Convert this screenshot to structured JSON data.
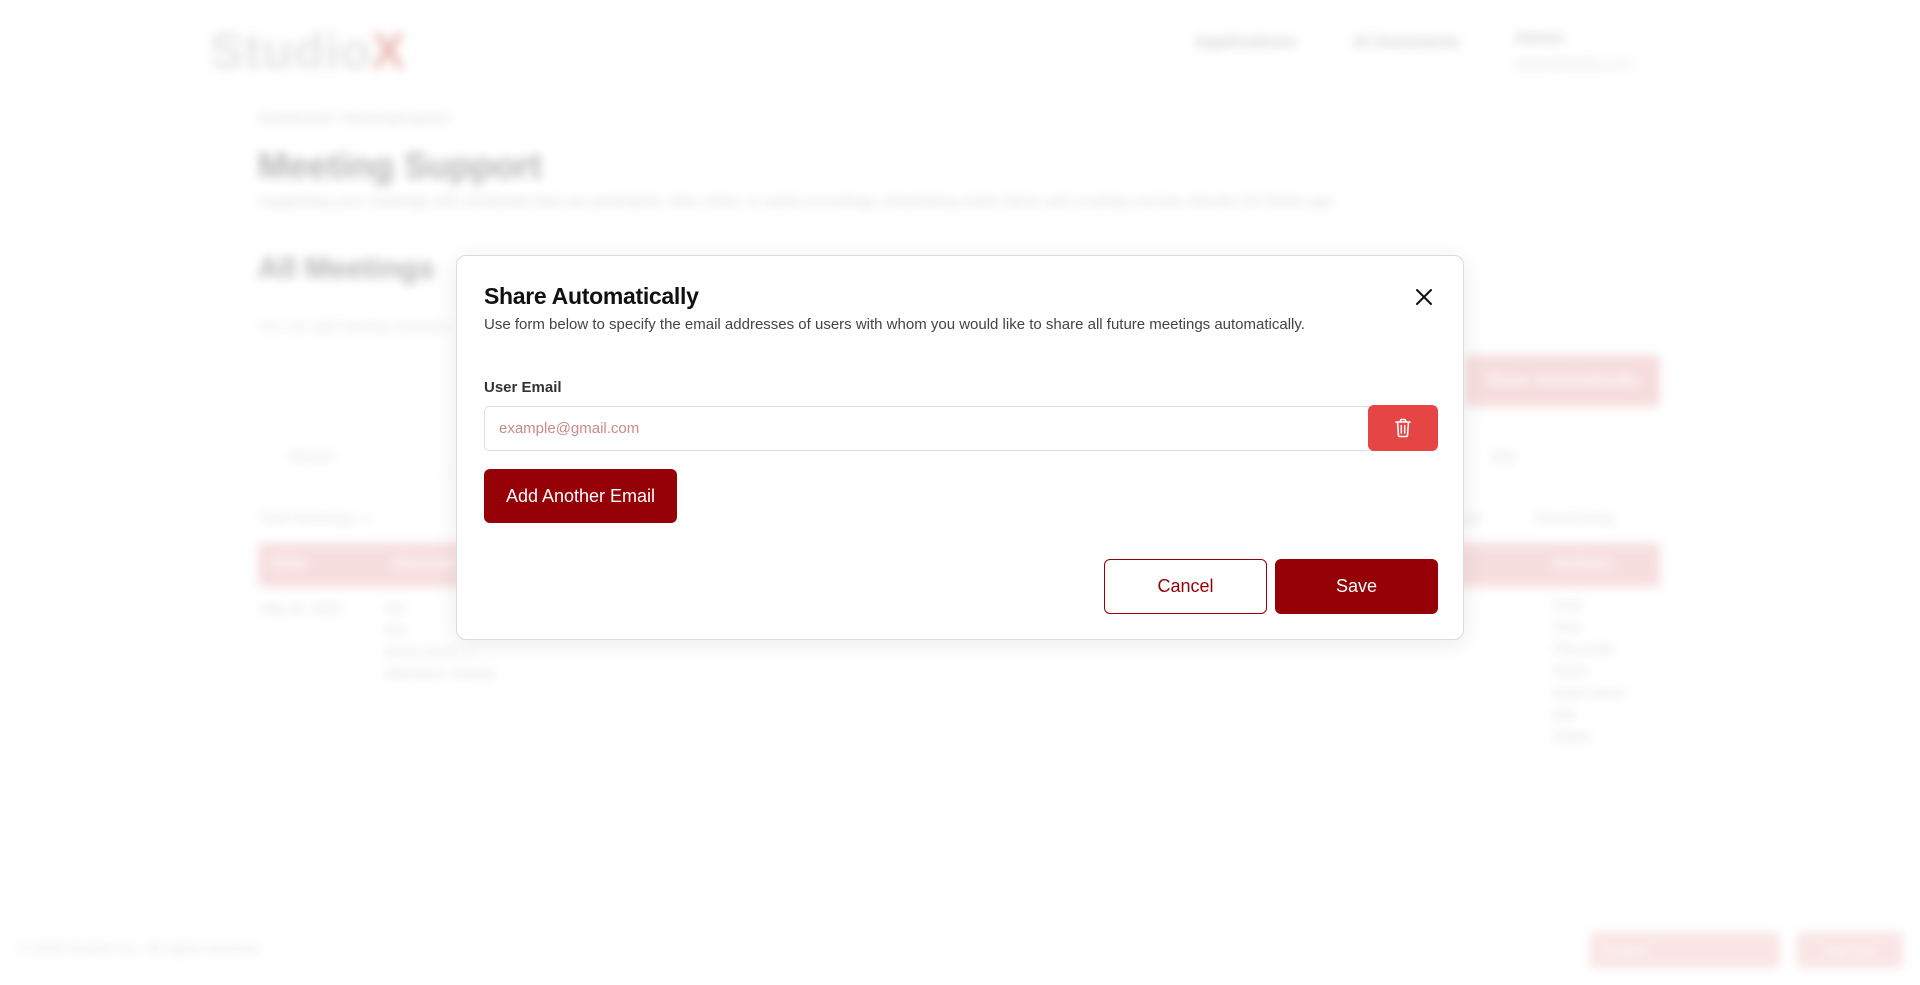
{
  "background": {
    "logo_text": "Studio",
    "logo_x": "X",
    "nav": [
      "Applications",
      "AI Assistants"
    ],
    "user_name": "Admin",
    "user_email": "admin@studiox.com",
    "breadcrumb": "Dashboard  /  MeetingSupport",
    "page_title": "Meeting Support",
    "page_subtitle": "Supporting your meetings with assistants that can participate, take notes, or audio recordings, pinpointing action items and creating concise minutes for follow-ups",
    "section_title": "All Meetings",
    "section_subtitle": "You can add meeting assistant",
    "share_button": "Share Automatically",
    "search_placeholder": "Search",
    "filter_select": "Any",
    "total_meetings": "Total Meetings: 1",
    "sort_by": "Date",
    "sort_order": "Descending",
    "table_headers": [
      "Date",
      "Description",
      "Actions"
    ],
    "row_date": "May 26, 2025",
    "row_description": [
      "test",
      "test",
      "Action Items: 1",
      "Attendees: Sample"
    ],
    "row_actions": [
      "Chat",
      "View",
      "Play Audio",
      "Share",
      "Action Items",
      "Edit",
      "Delete"
    ],
    "footer_copyright": "© 2025 StudioX Inc. All rights reserved.",
    "footer_language": "English",
    "footer_signout": "Sign Out"
  },
  "modal": {
    "title": "Share Automatically",
    "description": "Use form below to specify the email addresses of users with whom you would like to share all future meetings automatically.",
    "field_label": "User Email",
    "email_placeholder": "example@gmail.com",
    "email_value": "",
    "add_button": "Add Another Email",
    "cancel_button": "Cancel",
    "save_button": "Save",
    "close_icon": "close-icon",
    "delete_icon": "trash-icon"
  },
  "colors": {
    "primary": "#960007",
    "danger": "#e64545",
    "placeholder": "#c88a8a"
  }
}
